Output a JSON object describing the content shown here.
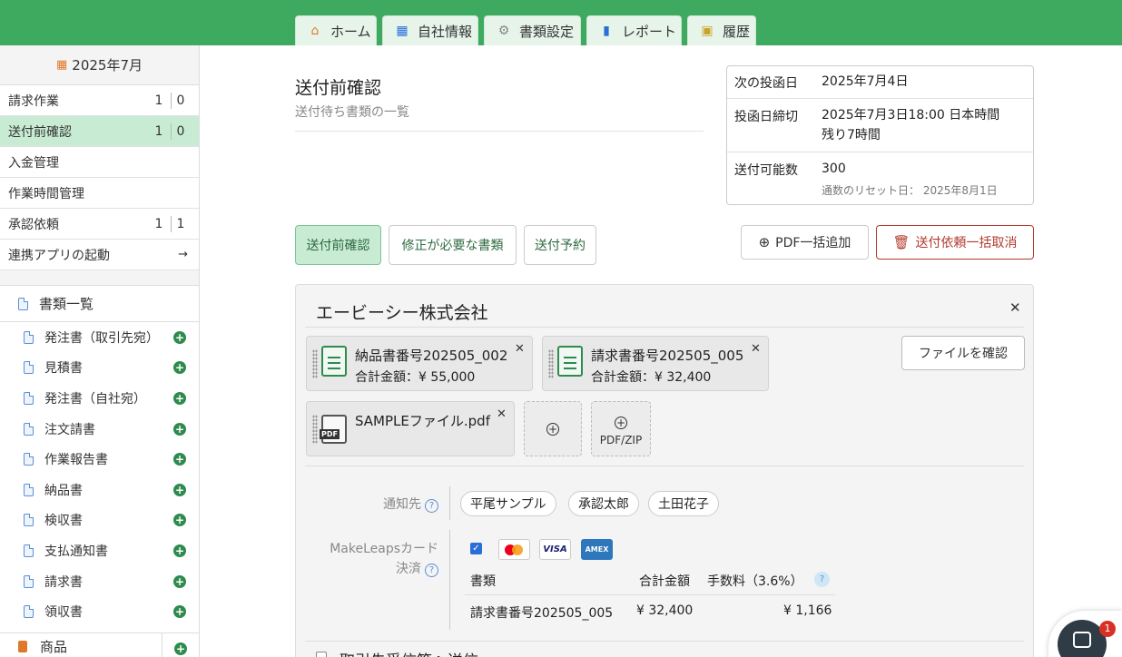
{
  "tabs": [
    {
      "label": "ホーム",
      "icon": "home-icon"
    },
    {
      "label": "自社情報",
      "icon": "building-icon"
    },
    {
      "label": "書類設定",
      "icon": "gear-icon"
    },
    {
      "label": "レポート",
      "icon": "chart-icon"
    },
    {
      "label": "履歴",
      "icon": "history-icon"
    }
  ],
  "sidebar": {
    "month": "2025年7月",
    "items": [
      {
        "label": "請求作業",
        "c1": "1",
        "c2": "0"
      },
      {
        "label": "送付前確認",
        "c1": "1",
        "c2": "0"
      },
      {
        "label": "入金管理"
      },
      {
        "label": "作業時間管理"
      },
      {
        "label": "承認依頼",
        "c1": "1",
        "c2": "1"
      },
      {
        "label": "連携アプリの起動",
        "arrow": "→"
      }
    ],
    "docs_title": "書類一覧",
    "docs": [
      "発注書（取引先宛）",
      "見積書",
      "発注書（自社宛）",
      "注文請書",
      "作業報告書",
      "納品書",
      "検収書",
      "支払通知書",
      "請求書",
      "領収書"
    ],
    "goods": "商品"
  },
  "page": {
    "title": "送付前確認",
    "subtitle": "送付待ち書類の一覧"
  },
  "info": {
    "next_post_label": "次の投函日",
    "next_post_value": "2025年7月4日",
    "deadline_label": "投函日締切",
    "deadline_value": "2025年7月3日18:00 日本時間",
    "deadline_remaining": "残り7時間",
    "sendable_label": "送付可能数",
    "sendable_value": "300",
    "reset_label": "通数のリセット日：",
    "reset_value": "2025年8月1日"
  },
  "filters": {
    "pre_send": "送付前確認",
    "needs_fix": "修正が必要な書類",
    "scheduled": "送付予約"
  },
  "actions": {
    "pdf_add": "PDF一括追加",
    "cancel_all": "送付依頼一括取消"
  },
  "card": {
    "company": "エービーシー株式会社",
    "docs": [
      {
        "name": "納品書番号202505_002",
        "amount": "合計金額：¥ 55,000"
      },
      {
        "name": "請求書番号202505_005",
        "amount": "合計金額：¥ 32,400"
      }
    ],
    "pdf_file": "SAMPLEファイル.pdf",
    "pdf_zip": "PDF/ZIP",
    "confirm_file": "ファイルを確認",
    "notify_label": "通知先",
    "notify": [
      "平尾サンプル",
      "承認太郎",
      "土田花子"
    ],
    "card_label_1": "MakeLeapsカード",
    "card_label_2": "決済",
    "table": {
      "headers": [
        "書類",
        "合計金額",
        "手数料（3.6%）"
      ],
      "rows": [
        [
          "請求書番号202505_005",
          "¥ 32,400",
          "¥ 1,166"
        ]
      ]
    },
    "cutoff_text": "取引先受信箱へ送信"
  },
  "chat_badge": "1"
}
